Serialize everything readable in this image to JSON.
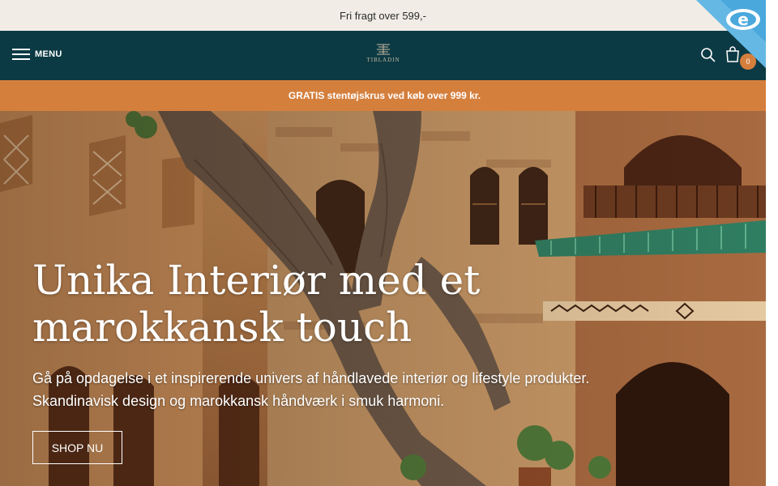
{
  "topbar": {
    "text": "Fri fragt over 599,-"
  },
  "header": {
    "menu_label": "MENU",
    "logo_text": "TIBLADIN",
    "cart_count": "0",
    "icons": {
      "menu": "hamburger-icon",
      "logo": "logo-mark-icon",
      "search": "search-icon",
      "cart": "shopping-bag-icon",
      "badge": "e-mark-badge-icon"
    }
  },
  "promo": {
    "icon": "",
    "text": "GRATIS stentøjskrus ved køb over 999 kr."
  },
  "hero": {
    "title_line1": "Unika Interiør med et",
    "title_line2": "marokkansk touch",
    "subtitle_line1": "Gå på opdagelse i et inspirerende univers af håndlavede interiør og lifestyle produkter.",
    "subtitle_line2": "Skandinavisk design og marokkansk håndværk i smuk harmoni.",
    "cta_label": "SHOP NU"
  },
  "colors": {
    "topbar_bg": "#f1ede6",
    "header_bg": "#0c3a44",
    "accent": "#d57f3d",
    "badge": "#4aa8dc"
  }
}
